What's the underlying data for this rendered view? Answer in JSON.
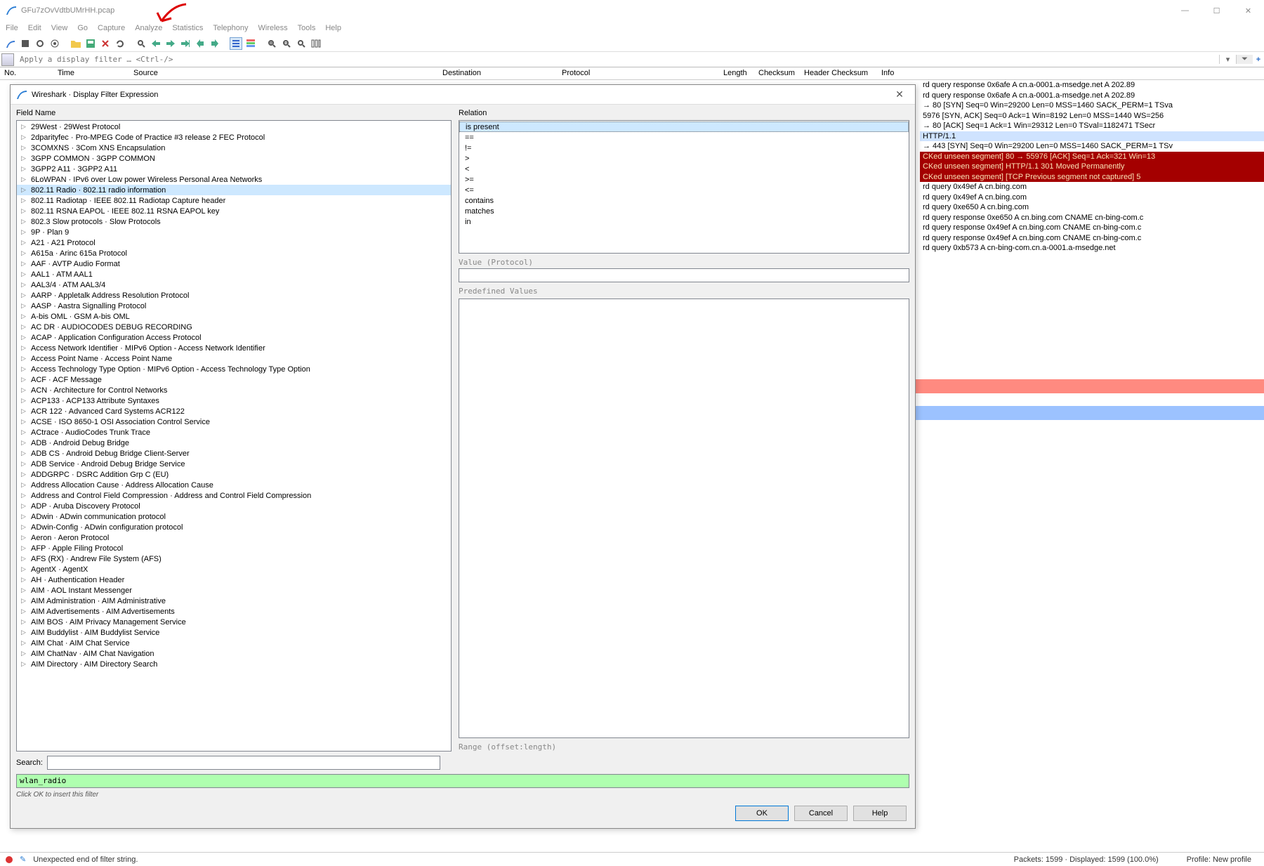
{
  "window": {
    "title": "GFu7zOvVdtbUMrHH.pcap",
    "controls": {
      "min": "—",
      "max": "☐",
      "close": "✕"
    }
  },
  "menu": [
    "File",
    "Edit",
    "View",
    "Go",
    "Capture",
    "Analyze",
    "Statistics",
    "Telephony",
    "Wireless",
    "Tools",
    "Help"
  ],
  "filter": {
    "placeholder": "Apply a display filter … <Ctrl-/>",
    "dropdown": "▾",
    "add": "+"
  },
  "columns": {
    "no": "No.",
    "time": "Time",
    "source": "Source",
    "destination": "Destination",
    "protocol": "Protocol",
    "length": "Length",
    "checksum": "Checksum",
    "hchecksum": "Header Checksum",
    "info": "Info"
  },
  "packets": [
    {
      "cls": "",
      "txt": "rd query response 0x6afe A cn.a-0001.a-msedge.net A 202.89"
    },
    {
      "cls": "",
      "txt": "rd query response 0x6afe A cn.a-0001.a-msedge.net A 202.89"
    },
    {
      "cls": "",
      "txt": "→ 80 [SYN] Seq=0 Win=29200 Len=0 MSS=1460 SACK_PERM=1 TSva"
    },
    {
      "cls": "",
      "txt": "5976 [SYN, ACK] Seq=0 Ack=1 Win=8192 Len=0 MSS=1440 WS=256"
    },
    {
      "cls": "",
      "txt": "→ 80 [ACK] Seq=1 Ack=1 Win=29312 Len=0 TSval=1182471 TSecr"
    },
    {
      "cls": "sel",
      "txt": "HTTP/1.1"
    },
    {
      "cls": "",
      "txt": "→ 443 [SYN] Seq=0 Win=29200 Len=0 MSS=1460 SACK_PERM=1 TSv"
    },
    {
      "cls": "err",
      "txt": "CKed unseen segment] 80 → 55976 [ACK] Seq=1 Ack=321 Win=13"
    },
    {
      "cls": "err",
      "txt": "CKed unseen segment] HTTP/1.1 301 Moved Permanently"
    },
    {
      "cls": "err",
      "txt": "CKed unseen segment] [TCP Previous segment not captured] 5"
    },
    {
      "cls": "",
      "txt": "rd query 0x49ef A cn.bing.com"
    },
    {
      "cls": "",
      "txt": "rd query 0x49ef A cn.bing.com"
    },
    {
      "cls": "",
      "txt": "rd query 0xe650 A cn.bing.com"
    },
    {
      "cls": "",
      "txt": "rd query response 0xe650 A cn.bing.com CNAME cn-bing-com.c"
    },
    {
      "cls": "",
      "txt": "rd query response 0x49ef A cn.bing.com CNAME cn-bing-com.c"
    },
    {
      "cls": "",
      "txt": "rd query response 0x49ef A cn.bing.com CNAME cn-bing-com.c"
    },
    {
      "cls": "",
      "txt": "rd query 0xb573 A cn-bing-com.cn.a-0001.a-msedge.net"
    }
  ],
  "dialog": {
    "title": "Wireshark · Display Filter Expression",
    "field_label": "Field Name",
    "relation_label": "Relation",
    "value_label": "Value (Protocol)",
    "predef_label": "Predefined Values",
    "range_label": "Range (offset:length)",
    "search_label": "Search:",
    "filter_value": "wlan_radio",
    "hint": "Click OK to insert this filter",
    "buttons": {
      "ok": "OK",
      "cancel": "Cancel",
      "help": "Help"
    },
    "fields": [
      "29West · 29West Protocol",
      "2dparityfec · Pro-MPEG Code of Practice #3 release 2 FEC Protocol",
      "3COMXNS · 3Com XNS Encapsulation",
      "3GPP COMMON · 3GPP COMMON",
      "3GPP2 A11 · 3GPP2 A11",
      "6LoWPAN · IPv6 over Low power Wireless Personal Area Networks",
      "802.11 Radio · 802.11 radio information",
      "802.11 Radiotap · IEEE 802.11 Radiotap Capture header",
      "802.11 RSNA EAPOL · IEEE 802.11 RSNA EAPOL key",
      "802.3 Slow protocols · Slow Protocols",
      "9P · Plan 9",
      "A21 · A21 Protocol",
      "A615a · Arinc 615a Protocol",
      "AAF · AVTP Audio Format",
      "AAL1 · ATM AAL1",
      "AAL3/4 · ATM AAL3/4",
      "AARP · Appletalk Address Resolution Protocol",
      "AASP · Aastra Signalling Protocol",
      "A-bis OML · GSM A-bis OML",
      "AC DR · AUDIOCODES DEBUG RECORDING",
      "ACAP · Application Configuration Access Protocol",
      "Access Network Identifier · MIPv6 Option - Access Network Identifier",
      "Access Point Name · Access Point Name",
      "Access Technology Type Option · MIPv6 Option - Access Technology Type Option",
      "ACF · ACF Message",
      "ACN · Architecture for Control Networks",
      "ACP133 · ACP133 Attribute Syntaxes",
      "ACR 122 · Advanced Card Systems ACR122",
      "ACSE · ISO 8650-1 OSI Association Control Service",
      "ACtrace · AudioCodes Trunk Trace",
      "ADB · Android Debug Bridge",
      "ADB CS · Android Debug Bridge Client-Server",
      "ADB Service · Android Debug Bridge Service",
      "ADDGRPC · DSRC Addition Grp C (EU)",
      "Address Allocation Cause · Address Allocation Cause",
      "Address and Control Field Compression · Address and Control Field Compression",
      "ADP · Aruba Discovery Protocol",
      "ADwin · ADwin communication protocol",
      "ADwin-Config · ADwin configuration protocol",
      "Aeron · Aeron Protocol",
      "AFP · Apple Filing Protocol",
      "AFS (RX) · Andrew File System (AFS)",
      "AgentX · AgentX",
      "AH · Authentication Header",
      "AIM · AOL Instant Messenger",
      "AIM Administration · AIM Administrative",
      "AIM Advertisements · AIM Advertisements",
      "AIM BOS · AIM Privacy Management Service",
      "AIM Buddylist · AIM Buddylist Service",
      "AIM Chat · AIM Chat Service",
      "AIM ChatNav · AIM Chat Navigation",
      "AIM Directory · AIM Directory Search"
    ],
    "selected_field_index": 6,
    "relations": [
      "is present",
      "==",
      "!=",
      ">",
      "<",
      ">=",
      "<=",
      "contains",
      "matches",
      "in"
    ],
    "selected_relation_index": 0
  },
  "status": {
    "msg": "Unexpected end of filter string.",
    "packets": "Packets: 1599 · Displayed: 1599 (100.0%)",
    "profile": "Profile: New profile"
  }
}
